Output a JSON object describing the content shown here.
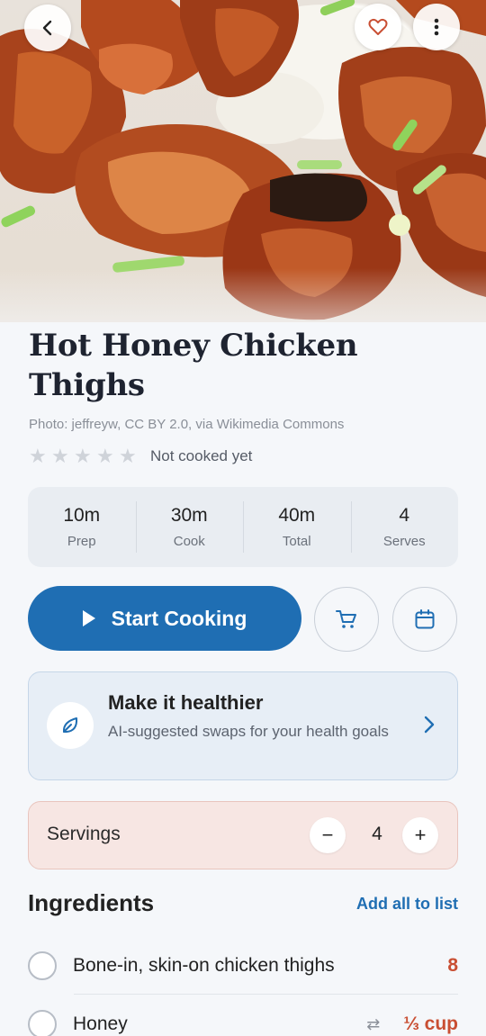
{
  "hero": {
    "photo_alt": "Hot honey chicken thighs with rice and scallions"
  },
  "nav": {
    "back_icon": "chevron-left-icon",
    "favorite_icon": "heart-icon",
    "more_icon": "more-vertical-icon"
  },
  "recipe": {
    "title": "Hot Honey Chicken Thighs",
    "credit": "Photo: jeffreyw, CC BY 2.0, via Wikimedia Commons",
    "rating": {
      "stars": 0,
      "max": 5,
      "text": "Not cooked yet"
    }
  },
  "stats": [
    {
      "value": "10m",
      "label": "Prep"
    },
    {
      "value": "30m",
      "label": "Cook"
    },
    {
      "value": "40m",
      "label": "Total"
    },
    {
      "value": "4",
      "label": "Serves"
    }
  ],
  "actions": {
    "start_label": "Start Cooking",
    "cart_icon": "cart-icon",
    "calendar_icon": "calendar-icon"
  },
  "healthier": {
    "title": "Make it healthier",
    "subtitle": "AI-suggested swaps for your health goals"
  },
  "servings": {
    "label": "Servings",
    "value": "4",
    "minus": "−",
    "plus": "+"
  },
  "ingredients": {
    "title": "Ingredients",
    "add_all": "Add all to list",
    "items": [
      {
        "name": "Bone-in, skin-on chicken thighs",
        "qty": "8",
        "swap": ""
      },
      {
        "name": "Honey",
        "qty": "⅓ cup",
        "swap": "⇄"
      }
    ]
  },
  "colors": {
    "primary": "#1f6eb3",
    "accent": "#c94f33",
    "servings_bg": "#f7e6e3",
    "health_bg": "#e7eef6"
  }
}
